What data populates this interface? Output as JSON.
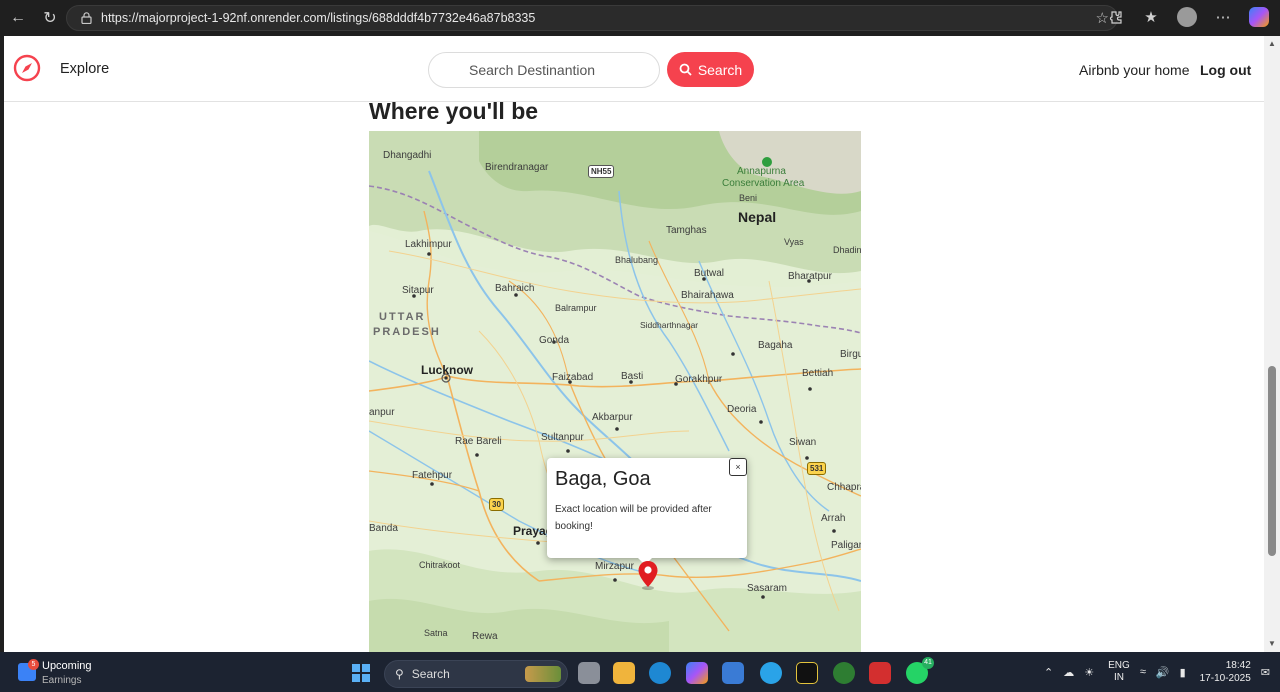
{
  "browser": {
    "url": "https://majorproject-1-92nf.onrender.com/listings/688dddf4b7732e46a87b8335",
    "icons": [
      "back-icon",
      "reload-icon",
      "lock-icon",
      "star-icon",
      "extensions-icon",
      "favorites-icon",
      "profile-icon",
      "more-icon",
      "copilot-icon"
    ]
  },
  "navbar": {
    "explore_label": "Explore",
    "search_placeholder": "Search Destinantion",
    "search_button_label": "Search",
    "host_label": "Airbnb your home",
    "logout_label": "Log out",
    "brand_color": "#f5424e"
  },
  "section": {
    "title": "Where you'll be"
  },
  "map": {
    "labels": {
      "dhangadhi": "Dhangadhi",
      "birendranagar": "Birendranagar",
      "nh55": "NH55",
      "annapurna1": "Annapurna",
      "annapurna2": "Conservation Area",
      "beni": "Beni",
      "nepal": "Nepal",
      "tamghas": "Tamghas",
      "vyas": "Vyas",
      "dhadin": "Dhadin",
      "lakhimpur": "Lakhimpur",
      "bhalubang": "Bhalubang",
      "butwal": "Butwal",
      "bharatpur": "Bharatpur",
      "sitapur": "Sitapur",
      "bahraich": "Bahraich",
      "bhairahawa": "Bhairahawa",
      "balrampur": "Balrampur",
      "uttar": "UTTAR",
      "pradesh": "PRADESH",
      "siddharthnagar": "Siddharthnagar",
      "gonda": "Gonda",
      "bagaha": "Bagaha",
      "birgunj": "Birgu",
      "lucknow": "Lucknow",
      "faizabad": "Faizabad",
      "basti": "Basti",
      "gorakhpur": "Gorakhpur",
      "bettiah": "Bettiah",
      "kanpur": "anpur",
      "deoria": "Deoria",
      "akbarpur": "Akbarpur",
      "raebareli": "Rae Bareli",
      "sultanpur": "Sultanpur",
      "siwan": "Siwan",
      "nh531": "531",
      "fatehpur": "Fatehpur",
      "chhapra": "Chhapra",
      "nh30": "30",
      "arrah": "Arrah",
      "banda": "Banda",
      "prayagraj": "Prayag",
      "paliganj": "Paligan",
      "chitrakoot": "Chitrakoot",
      "mirzapur": "Mirzapur",
      "sasaram": "Sasaram",
      "satna": "Satna",
      "rewa": "Rewa"
    },
    "popup": {
      "title": "Baga, Goa",
      "description": "Exact location will be provided after booking!",
      "close_label": "×"
    },
    "marker_color": "#e11d21"
  },
  "taskbar": {
    "weather_badge": "5",
    "weather_title": "Upcoming",
    "weather_subtitle": "Earnings",
    "search_label": "Search",
    "chrome_badge": "",
    "whatsapp_badge": "41",
    "lang_line1": "ENG",
    "lang_line2": "IN",
    "time": "18:42",
    "date": "17-10-2025"
  }
}
